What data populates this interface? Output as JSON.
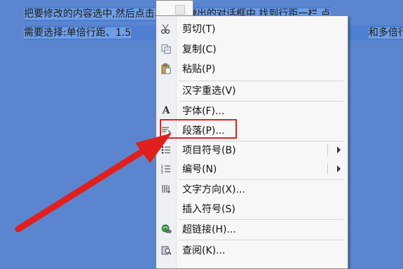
{
  "document": {
    "line1_before": "把要修改的内容选中,然后点击段落,在弹出的对话框中,找到行距一栏,点",
    "line2_a": "需要选择:单倍行距、1.5",
    "line2_b": "和多倍行距"
  },
  "context_menu": {
    "items": [
      {
        "label": "剪切(T)",
        "icon": "scissors-icon"
      },
      {
        "label": "复制(C)",
        "icon": "copy-icon"
      },
      {
        "label": "粘贴(P)",
        "icon": "paste-icon"
      },
      {
        "label": "汉字重选(V)",
        "icon": ""
      },
      {
        "label": "字体(F)...",
        "icon": "font-icon"
      },
      {
        "label": "段落(P)...",
        "icon": "paragraph-icon"
      },
      {
        "label": "项目符号(B)",
        "icon": "bullets-icon",
        "submenu": true
      },
      {
        "label": "编号(N)",
        "icon": "numbering-icon",
        "submenu": true
      },
      {
        "label": "文字方向(X)...",
        "icon": "text-direction-icon"
      },
      {
        "label": "插入符号(S)",
        "icon": ""
      },
      {
        "label": "超链接(H)...",
        "icon": "hyperlink-icon"
      },
      {
        "label": "查阅(K)...",
        "icon": "lookup-icon"
      }
    ]
  },
  "annotation": {
    "box_color": "#e0201e",
    "arrow_color": "#e0201e"
  }
}
